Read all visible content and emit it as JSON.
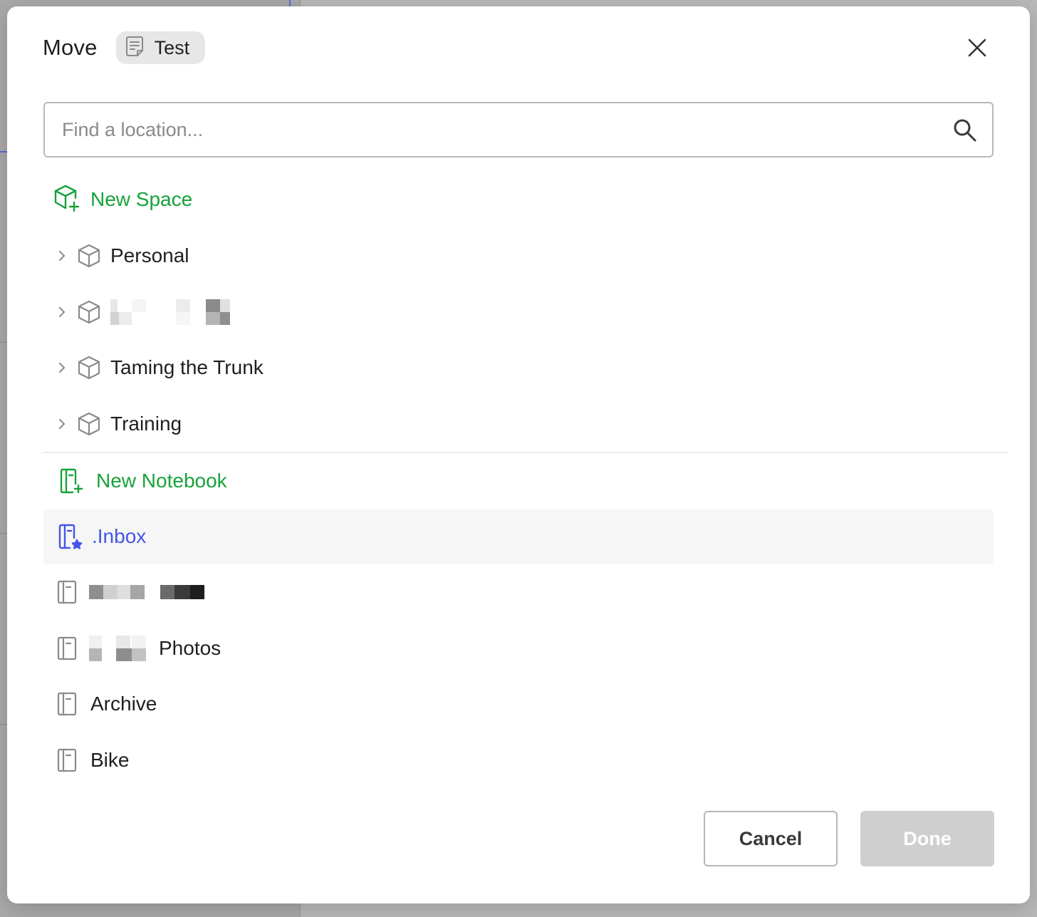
{
  "dialog": {
    "title": "Move",
    "item_chip": {
      "label": "Test",
      "icon": "note-icon"
    },
    "close_icon": "close-icon"
  },
  "search": {
    "placeholder": "Find a location...",
    "value": "",
    "icon": "search-icon"
  },
  "spaces": {
    "new_label": "New Space",
    "items": [
      {
        "label": "Personal",
        "redacted": false
      },
      {
        "label": "",
        "redacted": true
      },
      {
        "label": "Taming the Trunk",
        "redacted": false
      },
      {
        "label": "Training",
        "redacted": false
      }
    ]
  },
  "notebooks": {
    "new_label": "New Notebook",
    "items": [
      {
        "label": ".Inbox",
        "selected": true
      },
      {
        "label": "",
        "redacted": true
      },
      {
        "label": "Photos",
        "redacted_prefix": true
      },
      {
        "label": "Archive"
      },
      {
        "label": "Bike"
      }
    ]
  },
  "buttons": {
    "cancel": "Cancel",
    "done": "Done",
    "done_disabled": true
  },
  "colors": {
    "accent_green": "#17a23a",
    "selected_blue": "#4455e6",
    "disabled_button": "#cfcfcf"
  }
}
